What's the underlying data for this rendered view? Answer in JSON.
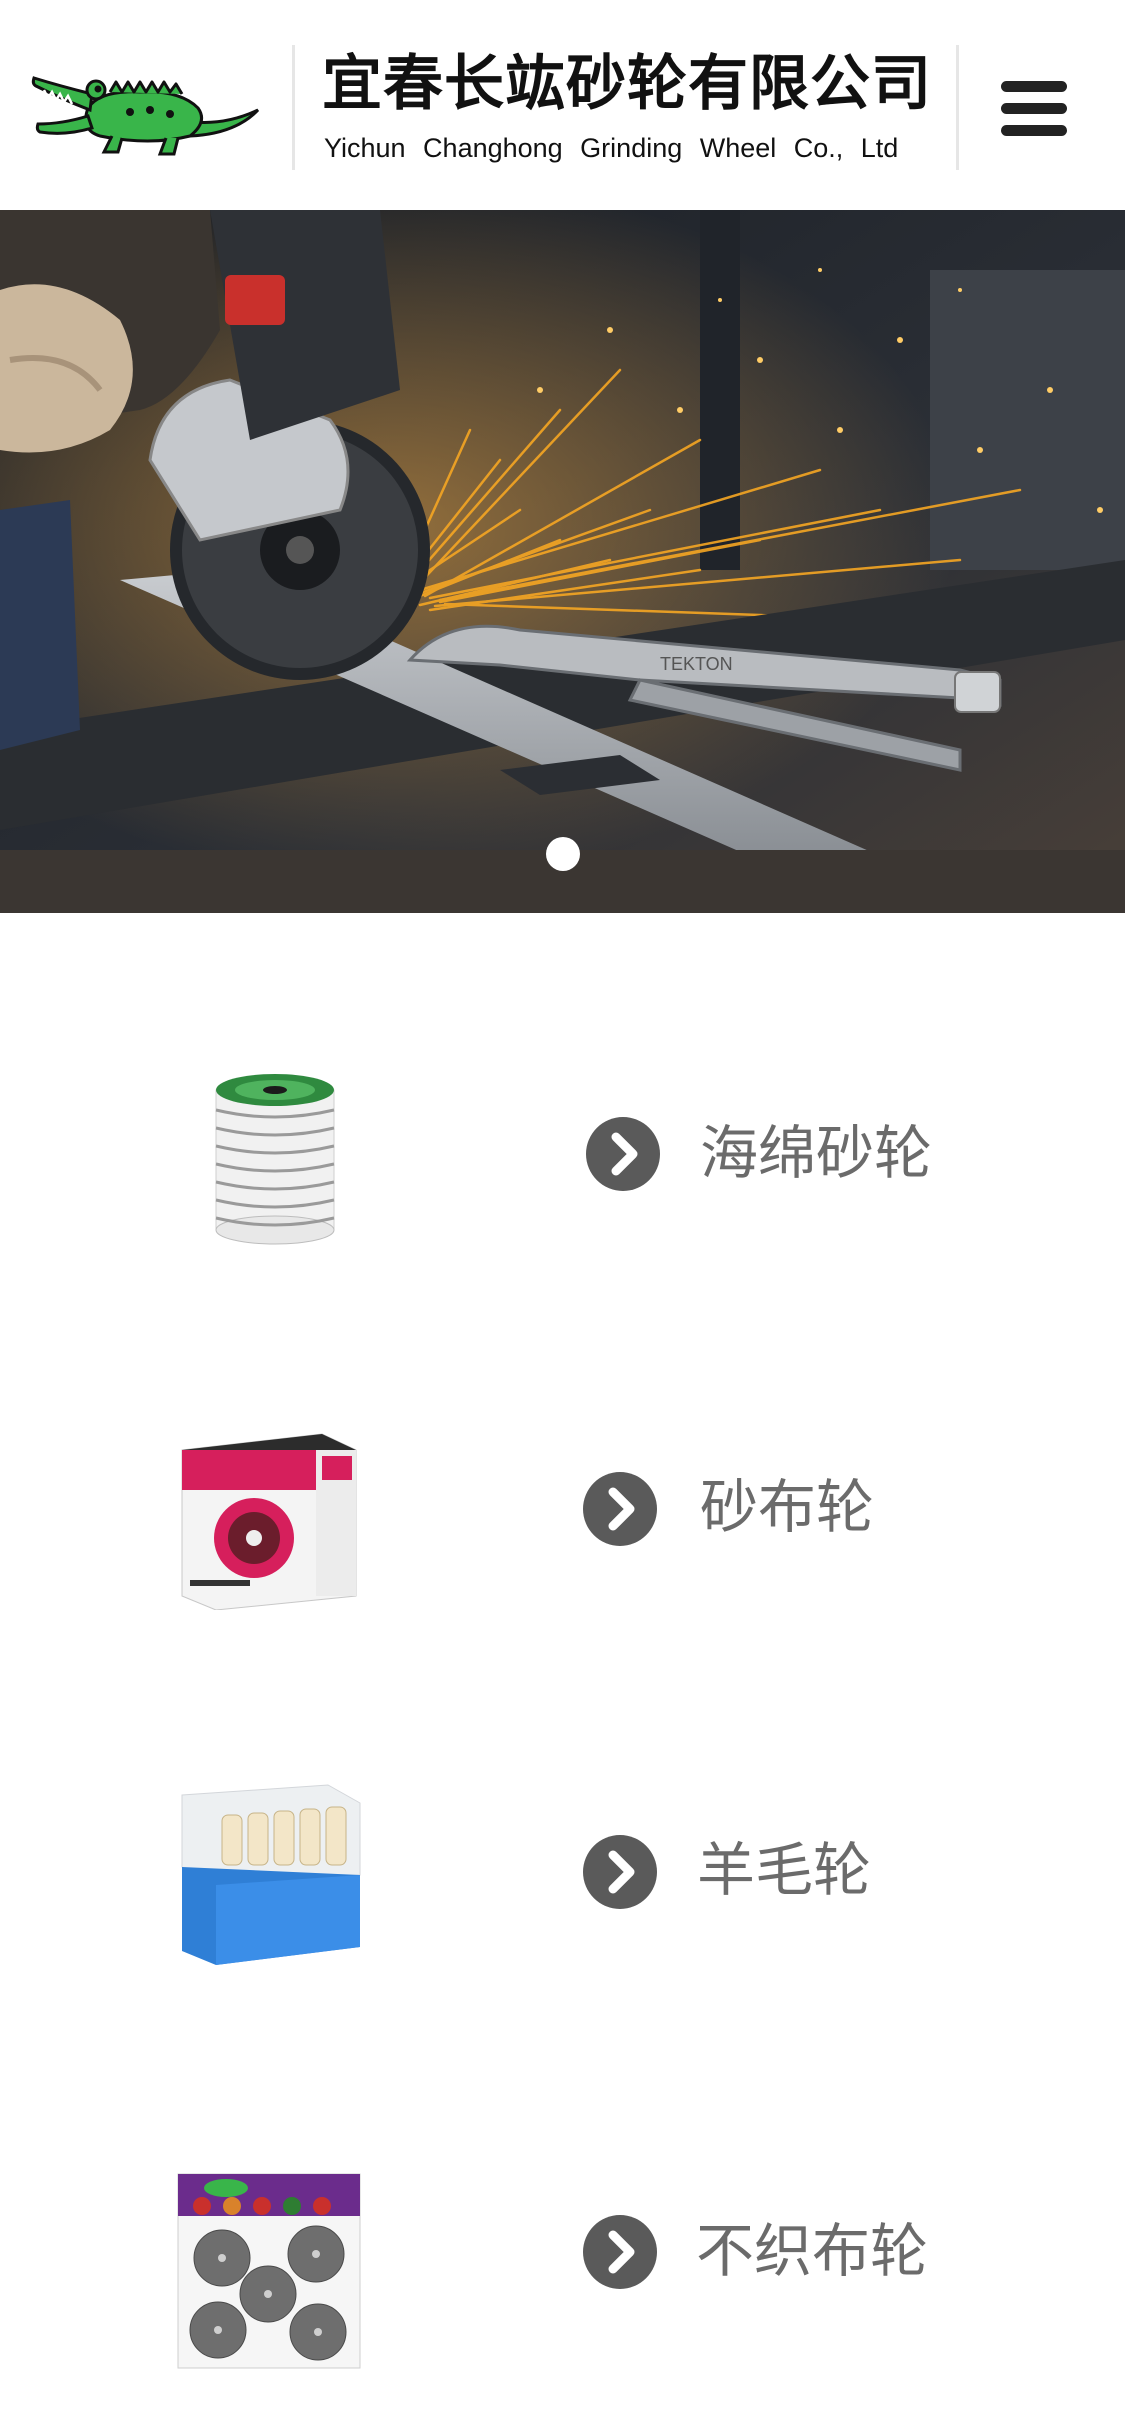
{
  "header": {
    "logo_icon": "crocodile-logo",
    "company_name_cn": "宜春长竑砂轮有限公司",
    "company_name_en": "Yichun Changhong Grinding Wheel Co., Ltd",
    "menu_icon": "hamburger-menu-icon"
  },
  "hero": {
    "image": "angle-grinder-cutting-steel-sparks",
    "stamp_text": "TEKTON",
    "slide_count": 1,
    "active_slide": 1
  },
  "products": [
    {
      "label": "海绵砂轮",
      "image": "sponge-grinding-wheel-stack",
      "icon": "chevron-right-circle-icon"
    },
    {
      "label": "砂布轮",
      "image": "flap-wheel-box",
      "icon": "chevron-right-circle-icon"
    },
    {
      "label": "羊毛轮",
      "image": "wool-wheel-box",
      "icon": "chevron-right-circle-icon"
    },
    {
      "label": "不织布轮",
      "image": "non-woven-wheel-pack",
      "icon": "chevron-right-circle-icon"
    }
  ],
  "colors": {
    "logo_green": "#39b54a",
    "arrow_circle": "#5a5a5a",
    "label_text": "#6b6b6b",
    "sparks": "#f5a623"
  }
}
